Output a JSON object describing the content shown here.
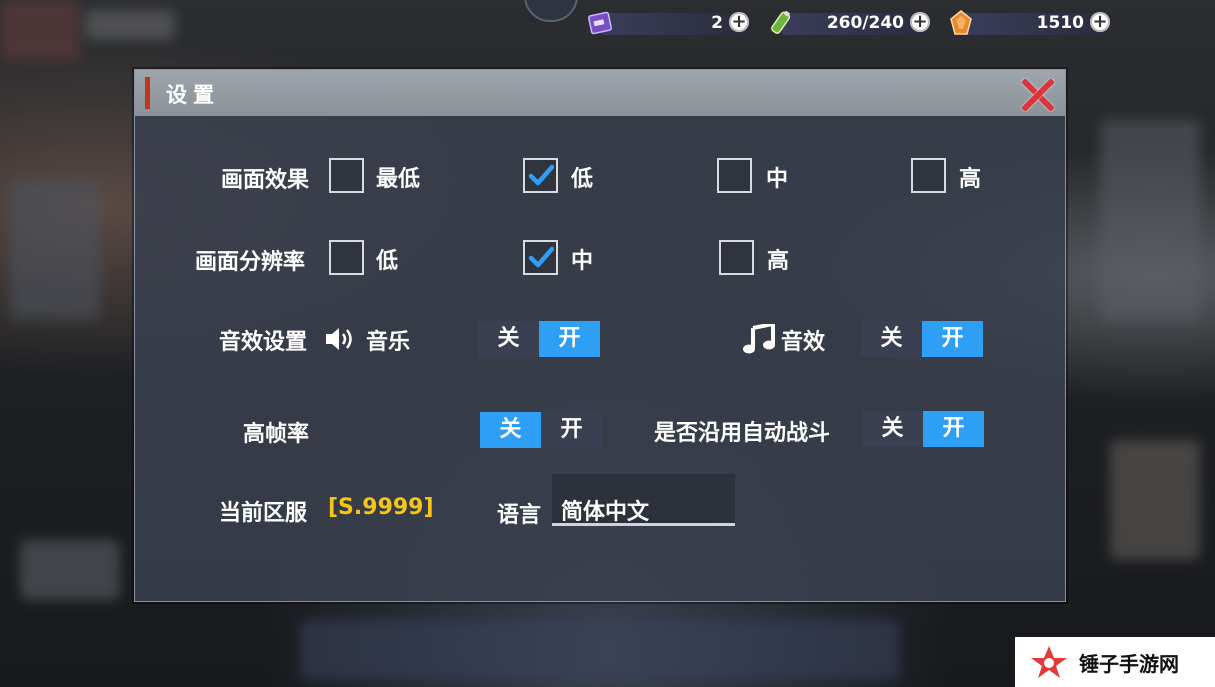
{
  "resources": [
    {
      "icon": "ticket-icon",
      "value": "2"
    },
    {
      "icon": "stamina-icon",
      "value": "260/240"
    },
    {
      "icon": "gem-icon",
      "value": "1510"
    }
  ],
  "dialog": {
    "title": "设置",
    "graphics": {
      "label": "画面效果",
      "options": [
        "最低",
        "低",
        "中",
        "高"
      ],
      "selected": "低"
    },
    "resolution": {
      "label": "画面分辨率",
      "options": [
        "低",
        "中",
        "高"
      ],
      "selected": "中"
    },
    "sound": {
      "label": "音效设置",
      "music_label": "音乐",
      "music_off": "关",
      "music_on": "开",
      "music_state": "开",
      "sfx_label": "音效",
      "sfx_off": "关",
      "sfx_on": "开",
      "sfx_state": "开"
    },
    "framerate": {
      "label": "高帧率",
      "off": "关",
      "on": "开",
      "state": "关"
    },
    "auto_battle": {
      "label": "是否沿用自动战斗",
      "off": "关",
      "on": "开",
      "state": "开"
    },
    "server": {
      "label": "当前区服",
      "value": "[S.9999]"
    },
    "language": {
      "label": "语言",
      "value": "简体中文"
    }
  },
  "watermark": "锤子手游网",
  "colors": {
    "accent": "#2f9ff5",
    "title_accent": "#c0361f",
    "server_gold": "#f5c518",
    "close": "#d8363c"
  }
}
